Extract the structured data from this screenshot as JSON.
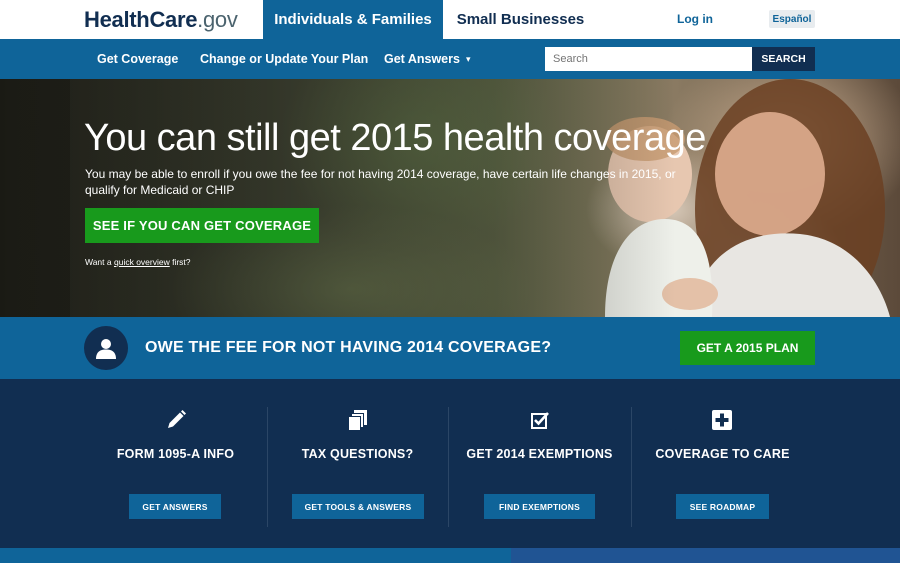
{
  "header": {
    "logo": {
      "part1": "Health",
      "part2": "Care",
      "part3": ".gov"
    },
    "tabs": [
      "Individuals & Families",
      "Small Businesses"
    ],
    "login": "Log in",
    "language": "Español"
  },
  "nav": {
    "items": [
      "Get Coverage",
      "Change or Update Your Plan",
      "Get Answers"
    ],
    "search": {
      "placeholder": "Search",
      "button": "SEARCH"
    }
  },
  "hero": {
    "title": "You can still get 2015 health coverage",
    "subtitle": "You may be able to enroll if you owe the fee for not having 2014 coverage, have certain life changes in 2015, or qualify for Medicaid or CHIP",
    "cta": "SEE IF YOU CAN GET COVERAGE",
    "quick_prefix": "Want a ",
    "quick_link": "quick overview",
    "quick_suffix": " first?"
  },
  "fee_band": {
    "title": "OWE THE FEE FOR NOT HAVING 2014 COVERAGE?",
    "button": "GET A 2015 PLAN"
  },
  "features": [
    {
      "icon": "pencil-icon",
      "title": "FORM 1095-A INFO",
      "button": "GET ANSWERS"
    },
    {
      "icon": "documents-icon",
      "title": "TAX QUESTIONS?",
      "button": "GET TOOLS & ANSWERS"
    },
    {
      "icon": "checkbox-icon",
      "title": "GET 2014 EXEMPTIONS",
      "button": "FIND EXEMPTIONS"
    },
    {
      "icon": "medical-cross-icon",
      "title": "COVERAGE TO CARE",
      "button": "SEE ROADMAP"
    }
  ],
  "colors": {
    "primary_blue": "#0f6499",
    "dark_navy": "#112e51",
    "green": "#189a1c"
  }
}
